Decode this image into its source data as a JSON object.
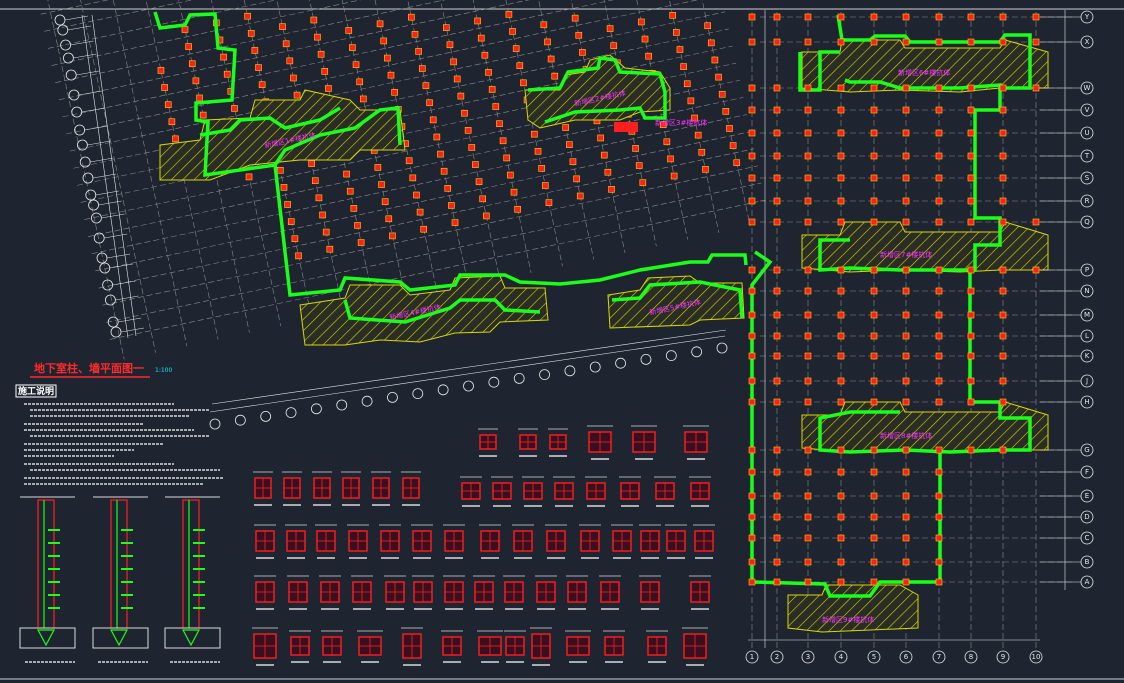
{
  "drawing": {
    "title": "地下室柱、墙平面图一",
    "scale": "1:100",
    "notes_heading": "施工说明"
  },
  "zones": [
    "新增区1#楼抗体",
    "新增区2#楼抗体",
    "新增区3#楼抗体",
    "新增区4#楼抗体",
    "新增区5#楼抗体",
    "新增区6#楼抗体",
    "新增区7#楼抗体",
    "新增区8#楼抗体",
    "新增区9#楼抗体"
  ],
  "axes": {
    "right_letters": [
      "Y",
      "X",
      "W",
      "V",
      "U",
      "T",
      "S",
      "R",
      "Q",
      "P",
      "N",
      "M",
      "L",
      "K",
      "J",
      "H",
      "G",
      "F",
      "E",
      "D",
      "C",
      "B",
      "A"
    ],
    "bottom_numbers": [
      "1",
      "2",
      "3",
      "4",
      "5",
      "6",
      "7",
      "8",
      "9",
      "10"
    ]
  },
  "colors": {
    "background": "#1f2530",
    "wall": "#19ff19",
    "column": "#ff1f1f",
    "hatch": "#d8d800",
    "grid": "#8a8a8a",
    "label": "#ff33ff"
  }
}
